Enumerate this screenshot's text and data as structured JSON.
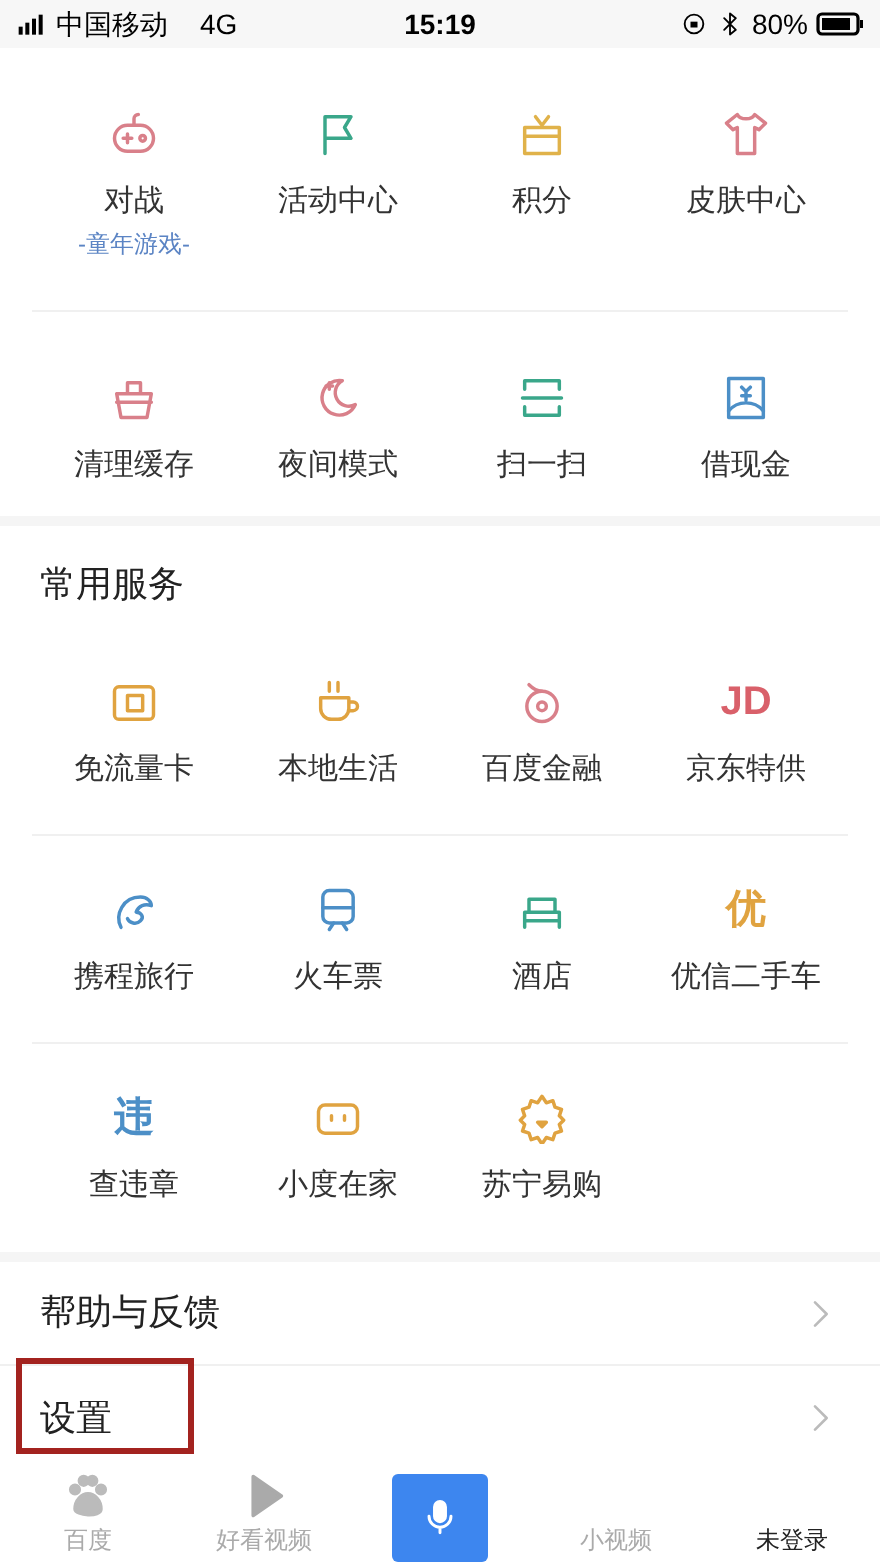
{
  "status_bar": {
    "carrier": "中国移动",
    "network": "4G",
    "time": "15:19",
    "battery": "80%"
  },
  "tools": [
    {
      "label": "对战",
      "sublabel": "-童年游戏-"
    },
    {
      "label": "活动中心"
    },
    {
      "label": "积分"
    },
    {
      "label": "皮肤中心"
    },
    {
      "label": "清理缓存"
    },
    {
      "label": "夜间模式"
    },
    {
      "label": "扫一扫"
    },
    {
      "label": "借现金"
    }
  ],
  "services": {
    "title": "常用服务",
    "items": [
      {
        "label": "免流量卡"
      },
      {
        "label": "本地生活"
      },
      {
        "label": "百度金融"
      },
      {
        "label": "京东特供",
        "icon_text": "JD"
      },
      {
        "label": "携程旅行"
      },
      {
        "label": "火车票"
      },
      {
        "label": "酒店"
      },
      {
        "label": "优信二手车",
        "icon_text": "优"
      },
      {
        "label": "查违章",
        "icon_text": "违"
      },
      {
        "label": "小度在家"
      },
      {
        "label": "苏宁易购"
      }
    ]
  },
  "menu": [
    {
      "label": "帮助与反馈",
      "highlighted": false
    },
    {
      "label": "设置",
      "highlighted": true
    }
  ],
  "nav": [
    {
      "kind": "tab",
      "label": "百度",
      "selected": false
    },
    {
      "kind": "tab",
      "label": "好看视频",
      "selected": false
    },
    {
      "kind": "voice"
    },
    {
      "kind": "tab",
      "label": "小视频",
      "selected": false
    },
    {
      "kind": "tab",
      "label": "未登录",
      "selected": true
    }
  ]
}
